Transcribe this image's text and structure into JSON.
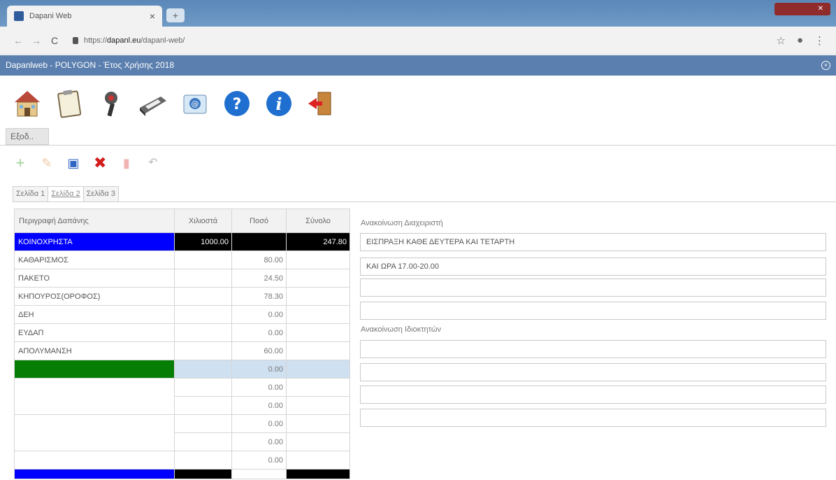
{
  "browser": {
    "tab_title": "Dapani Web",
    "url_prefix": "https://",
    "url_domain": "dapanl.eu",
    "url_path": "/dapanl-web/"
  },
  "app": {
    "header_title": "Dapanlweb - POLYGON - Έτος Χρήσης 2018",
    "menu_tab_label": "Εξοδ..",
    "page_tabs": [
      "Σελίδα 1",
      "Σελίδα 2",
      "Σελίδα 3"
    ]
  },
  "toolbar_icons": [
    "home-icon",
    "clipboard-icon",
    "settings-icon",
    "printer-icon",
    "email-icon",
    "help-icon",
    "info-icon",
    "exit-icon"
  ],
  "action_icons": [
    "add-icon",
    "edit-icon",
    "save-icon",
    "delete-icon",
    "trash-icon",
    "undo-icon"
  ],
  "colors": {
    "header": "#5b7fae",
    "highlight_row": "#0000ff",
    "green_cell": "#067e06",
    "selected": "#cfe0f1"
  },
  "table": {
    "headers": [
      "Περιγραφή Δαπάνης",
      "Χιλιοστά",
      "Ποσό",
      "Σύνολο"
    ],
    "rows": [
      {
        "desc": "ΚΟΙΝΟΧΡΗΣΤΑ",
        "mill": "1000.00",
        "amount": "",
        "total": "247.80"
      },
      {
        "desc": "ΚΑΘΑΡΙΣΜΟΣ",
        "mill": "",
        "amount": "80.00",
        "total": ""
      },
      {
        "desc": "ΠΑΚΕΤΟ",
        "mill": "",
        "amount": "24.50",
        "total": ""
      },
      {
        "desc": "ΚΗΠΟΥΡΟΣ(ΟΡΟΦΟΣ)",
        "mill": "",
        "amount": "78.30",
        "total": ""
      },
      {
        "desc": "ΔΕΗ",
        "mill": "",
        "amount": "0.00",
        "total": ""
      },
      {
        "desc": "ΕΥΔΑΠ",
        "mill": "",
        "amount": "0.00",
        "total": ""
      },
      {
        "desc": "ΑΠΟΛΥΜΑΝΣΗ",
        "mill": "",
        "amount": "60.00",
        "total": ""
      },
      {
        "desc": "",
        "mill": "",
        "amount": "0.00",
        "total": ""
      },
      {
        "desc": "",
        "mill": "",
        "amount": "0.00",
        "total": ""
      },
      {
        "desc": "",
        "mill": "",
        "amount": "0.00",
        "total": ""
      },
      {
        "desc": "",
        "mill": "",
        "amount": "0.00",
        "total": ""
      },
      {
        "desc": "",
        "mill": "",
        "amount": "0.00",
        "total": ""
      },
      {
        "desc": "",
        "mill": "",
        "amount": "0.00",
        "total": ""
      }
    ]
  },
  "announcements": {
    "manager_title": "Ανακοίνωση Διαχειριστή",
    "manager_lines": [
      "ΕΙΣΠΡΑΞΗ ΚΑΘΕ ΔΕΥΤΕΡΑ ΚΑΙ ΤΕΤΑΡΤΗ",
      "ΚΑΙ ΩΡΑ 17.00-20.00",
      "",
      ""
    ],
    "owners_title": "Ανακοίνωση Ιδιοκτητών",
    "owners_lines": [
      "",
      "",
      "",
      ""
    ]
  }
}
